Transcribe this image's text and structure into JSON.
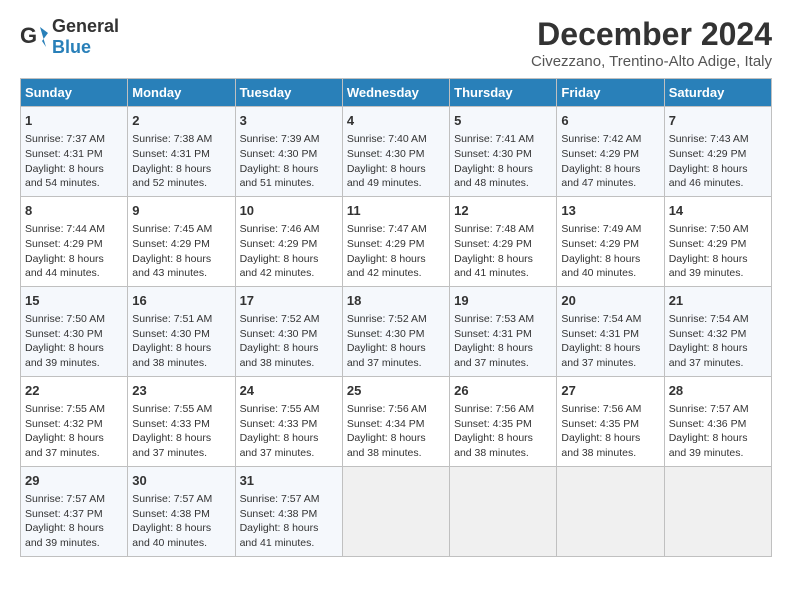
{
  "header": {
    "logo_general": "General",
    "logo_blue": "Blue",
    "title": "December 2024",
    "subtitle": "Civezzano, Trentino-Alto Adige, Italy"
  },
  "columns": [
    "Sunday",
    "Monday",
    "Tuesday",
    "Wednesday",
    "Thursday",
    "Friday",
    "Saturday"
  ],
  "weeks": [
    [
      {
        "day": "1",
        "sunrise": "Sunrise: 7:37 AM",
        "sunset": "Sunset: 4:31 PM",
        "daylight": "Daylight: 8 hours and 54 minutes."
      },
      {
        "day": "2",
        "sunrise": "Sunrise: 7:38 AM",
        "sunset": "Sunset: 4:31 PM",
        "daylight": "Daylight: 8 hours and 52 minutes."
      },
      {
        "day": "3",
        "sunrise": "Sunrise: 7:39 AM",
        "sunset": "Sunset: 4:30 PM",
        "daylight": "Daylight: 8 hours and 51 minutes."
      },
      {
        "day": "4",
        "sunrise": "Sunrise: 7:40 AM",
        "sunset": "Sunset: 4:30 PM",
        "daylight": "Daylight: 8 hours and 49 minutes."
      },
      {
        "day": "5",
        "sunrise": "Sunrise: 7:41 AM",
        "sunset": "Sunset: 4:30 PM",
        "daylight": "Daylight: 8 hours and 48 minutes."
      },
      {
        "day": "6",
        "sunrise": "Sunrise: 7:42 AM",
        "sunset": "Sunset: 4:29 PM",
        "daylight": "Daylight: 8 hours and 47 minutes."
      },
      {
        "day": "7",
        "sunrise": "Sunrise: 7:43 AM",
        "sunset": "Sunset: 4:29 PM",
        "daylight": "Daylight: 8 hours and 46 minutes."
      }
    ],
    [
      {
        "day": "8",
        "sunrise": "Sunrise: 7:44 AM",
        "sunset": "Sunset: 4:29 PM",
        "daylight": "Daylight: 8 hours and 44 minutes."
      },
      {
        "day": "9",
        "sunrise": "Sunrise: 7:45 AM",
        "sunset": "Sunset: 4:29 PM",
        "daylight": "Daylight: 8 hours and 43 minutes."
      },
      {
        "day": "10",
        "sunrise": "Sunrise: 7:46 AM",
        "sunset": "Sunset: 4:29 PM",
        "daylight": "Daylight: 8 hours and 42 minutes."
      },
      {
        "day": "11",
        "sunrise": "Sunrise: 7:47 AM",
        "sunset": "Sunset: 4:29 PM",
        "daylight": "Daylight: 8 hours and 42 minutes."
      },
      {
        "day": "12",
        "sunrise": "Sunrise: 7:48 AM",
        "sunset": "Sunset: 4:29 PM",
        "daylight": "Daylight: 8 hours and 41 minutes."
      },
      {
        "day": "13",
        "sunrise": "Sunrise: 7:49 AM",
        "sunset": "Sunset: 4:29 PM",
        "daylight": "Daylight: 8 hours and 40 minutes."
      },
      {
        "day": "14",
        "sunrise": "Sunrise: 7:50 AM",
        "sunset": "Sunset: 4:29 PM",
        "daylight": "Daylight: 8 hours and 39 minutes."
      }
    ],
    [
      {
        "day": "15",
        "sunrise": "Sunrise: 7:50 AM",
        "sunset": "Sunset: 4:30 PM",
        "daylight": "Daylight: 8 hours and 39 minutes."
      },
      {
        "day": "16",
        "sunrise": "Sunrise: 7:51 AM",
        "sunset": "Sunset: 4:30 PM",
        "daylight": "Daylight: 8 hours and 38 minutes."
      },
      {
        "day": "17",
        "sunrise": "Sunrise: 7:52 AM",
        "sunset": "Sunset: 4:30 PM",
        "daylight": "Daylight: 8 hours and 38 minutes."
      },
      {
        "day": "18",
        "sunrise": "Sunrise: 7:52 AM",
        "sunset": "Sunset: 4:30 PM",
        "daylight": "Daylight: 8 hours and 37 minutes."
      },
      {
        "day": "19",
        "sunrise": "Sunrise: 7:53 AM",
        "sunset": "Sunset: 4:31 PM",
        "daylight": "Daylight: 8 hours and 37 minutes."
      },
      {
        "day": "20",
        "sunrise": "Sunrise: 7:54 AM",
        "sunset": "Sunset: 4:31 PM",
        "daylight": "Daylight: 8 hours and 37 minutes."
      },
      {
        "day": "21",
        "sunrise": "Sunrise: 7:54 AM",
        "sunset": "Sunset: 4:32 PM",
        "daylight": "Daylight: 8 hours and 37 minutes."
      }
    ],
    [
      {
        "day": "22",
        "sunrise": "Sunrise: 7:55 AM",
        "sunset": "Sunset: 4:32 PM",
        "daylight": "Daylight: 8 hours and 37 minutes."
      },
      {
        "day": "23",
        "sunrise": "Sunrise: 7:55 AM",
        "sunset": "Sunset: 4:33 PM",
        "daylight": "Daylight: 8 hours and 37 minutes."
      },
      {
        "day": "24",
        "sunrise": "Sunrise: 7:55 AM",
        "sunset": "Sunset: 4:33 PM",
        "daylight": "Daylight: 8 hours and 37 minutes."
      },
      {
        "day": "25",
        "sunrise": "Sunrise: 7:56 AM",
        "sunset": "Sunset: 4:34 PM",
        "daylight": "Daylight: 8 hours and 38 minutes."
      },
      {
        "day": "26",
        "sunrise": "Sunrise: 7:56 AM",
        "sunset": "Sunset: 4:35 PM",
        "daylight": "Daylight: 8 hours and 38 minutes."
      },
      {
        "day": "27",
        "sunrise": "Sunrise: 7:56 AM",
        "sunset": "Sunset: 4:35 PM",
        "daylight": "Daylight: 8 hours and 38 minutes."
      },
      {
        "day": "28",
        "sunrise": "Sunrise: 7:57 AM",
        "sunset": "Sunset: 4:36 PM",
        "daylight": "Daylight: 8 hours and 39 minutes."
      }
    ],
    [
      {
        "day": "29",
        "sunrise": "Sunrise: 7:57 AM",
        "sunset": "Sunset: 4:37 PM",
        "daylight": "Daylight: 8 hours and 39 minutes."
      },
      {
        "day": "30",
        "sunrise": "Sunrise: 7:57 AM",
        "sunset": "Sunset: 4:38 PM",
        "daylight": "Daylight: 8 hours and 40 minutes."
      },
      {
        "day": "31",
        "sunrise": "Sunrise: 7:57 AM",
        "sunset": "Sunset: 4:38 PM",
        "daylight": "Daylight: 8 hours and 41 minutes."
      },
      null,
      null,
      null,
      null
    ]
  ]
}
